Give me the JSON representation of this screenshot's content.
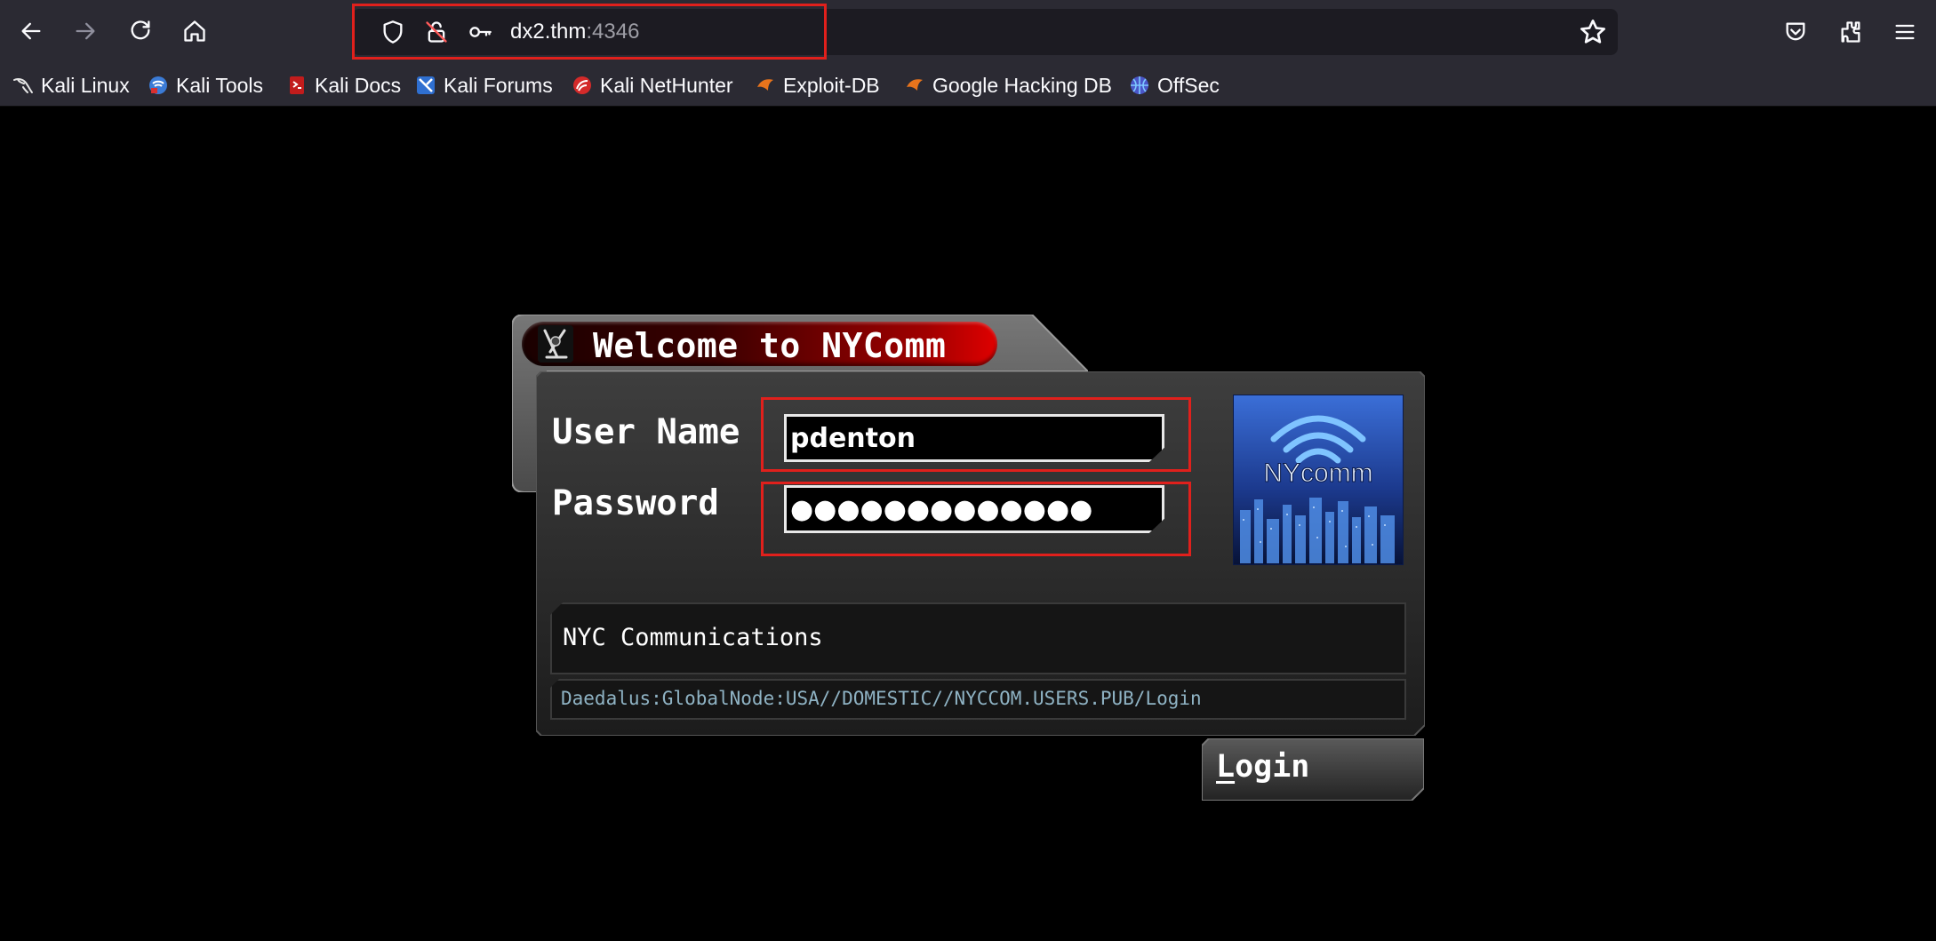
{
  "browser": {
    "url_host": "dx2.thm",
    "url_port": ":4346",
    "bookmarks": [
      {
        "label": "Kali Linux",
        "icon": "kali-dragon-icon"
      },
      {
        "label": "Kali Tools",
        "icon": "kali-tools-icon"
      },
      {
        "label": "Kali Docs",
        "icon": "kali-docs-icon"
      },
      {
        "label": "Kali Forums",
        "icon": "kali-forums-icon"
      },
      {
        "label": "Kali NetHunter",
        "icon": "kali-nethunter-icon"
      },
      {
        "label": "Exploit-DB",
        "icon": "exploit-db-icon"
      },
      {
        "label": "Google Hacking DB",
        "icon": "ghdb-icon"
      },
      {
        "label": "OffSec",
        "icon": "offsec-icon"
      }
    ]
  },
  "login": {
    "title": "Welcome to NYComm",
    "username_label": "User Name",
    "username_value": "pdenton",
    "password_label": "Password",
    "password_value": "●●●●●●●●●●●●●",
    "logo_text": "NYcomm",
    "info_text": "NYC Communications",
    "path_text": "Daedalus:GlobalNode:USA//DOMESTIC//NYCCOM.USERS.PUB/Login",
    "login_first_letter": "L",
    "login_rest": "ogin"
  },
  "colors": {
    "highlight": "#e0201c",
    "panel": "#3c3c3c",
    "path_text": "#8fb3c4"
  }
}
